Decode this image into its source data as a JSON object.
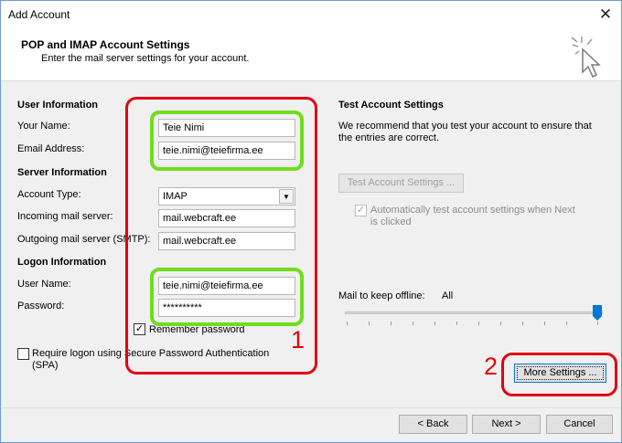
{
  "window": {
    "title": "Add Account",
    "close_glyph": "✕"
  },
  "header": {
    "title": "POP and IMAP Account Settings",
    "subtitle": "Enter the mail server settings for your account."
  },
  "user_info": {
    "heading": "User Information",
    "name_label": "Your Name:",
    "name_value": "Teie Nimi",
    "email_label": "Email Address:",
    "email_value": "teie.nimi@teiefirma.ee"
  },
  "server_info": {
    "heading": "Server Information",
    "account_type_label": "Account Type:",
    "account_type_value": "IMAP",
    "incoming_label": "Incoming mail server:",
    "incoming_value": "mail.webcraft.ee",
    "outgoing_label": "Outgoing mail server (SMTP):",
    "outgoing_value": "mail.webcraft.ee"
  },
  "logon_info": {
    "heading": "Logon Information",
    "username_label": "User Name:",
    "username_value": "teie.nimi@teiefirma.ee",
    "password_label": "Password:",
    "password_value": "**********",
    "remember_label": "Remember password",
    "remember_checked": true,
    "spa_label_line1": "Require logon using Secure Password Authentication",
    "spa_label_line2": "(SPA)",
    "spa_checked": false
  },
  "test_settings": {
    "heading": "Test Account Settings",
    "description_line1": "We recommend that you test your account to ensure that",
    "description_line2": "the entries are correct.",
    "test_button": "Test Account Settings ...",
    "auto_test_line1": "Automatically test account settings when Next",
    "auto_test_line2": "is clicked",
    "auto_test_checked": true
  },
  "offline": {
    "label": "Mail to keep offline:",
    "value": "All",
    "slider_position_fraction": 1.0
  },
  "more_settings_button": "More Settings ...",
  "footer": {
    "back_button": "< Back",
    "next_button": "Next >",
    "cancel_button": "Cancel"
  },
  "annotations": {
    "number_1": "1",
    "number_2": "2",
    "red_color": "#e20010",
    "green_color": "#6fdd1c"
  }
}
